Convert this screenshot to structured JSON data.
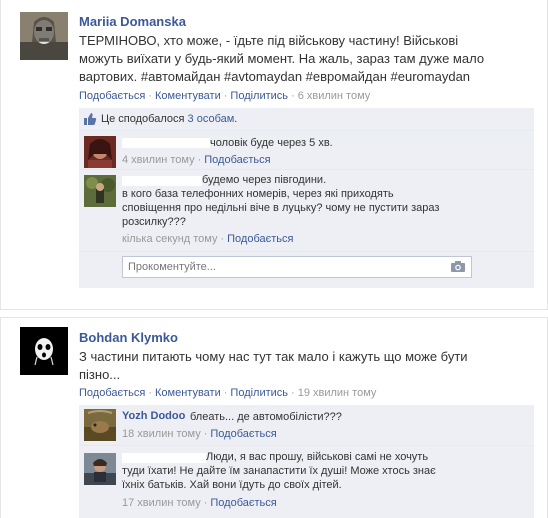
{
  "post1": {
    "author": "Mariia Domanska",
    "text_lines": [
      "ТЕРМІНОВО, хто може, - їдьте під військову частину! Військові",
      "можуть виїхати у будь-який момент. На жаль, зараз там дуже мало",
      "вартових. #автомайдан #avtomaydan #евромайдан #euromaydan"
    ],
    "actions": {
      "like": "Подобається",
      "comment": "Коментувати",
      "share": "Поділитись",
      "time": "6 хвилин тому"
    },
    "likes": {
      "prefix": "Це сподобалося ",
      "count_link": "3 особам",
      "suffix": "."
    },
    "comments": [
      {
        "text_lines": [
          "чоловік буде через 5 хв."
        ],
        "time": "4 хвилин тому",
        "like": "Подобається"
      },
      {
        "text_lines": [
          "будемо через півгодини.",
          "в кого база телефонних номерів, через які приходять",
          "сповіщення про недільні віче в луцьку? чому не пустити зараз",
          "розсилку???"
        ],
        "time": "кілька секунд тому",
        "like": "Подобається"
      }
    ],
    "reply_placeholder": "Прокоментуйте..."
  },
  "post2": {
    "author": "Bohdan Klymko",
    "text_lines": [
      "З частини питають чому нас тут так мало і кажуть що може бути",
      "пізно..."
    ],
    "actions": {
      "like": "Подобається",
      "comment": "Коментувати",
      "share": "Поділитись",
      "time": "19 хвилин тому"
    },
    "comments": [
      {
        "author": "Yozh Dodoo",
        "text_lines": [
          "блеать... де автомобілісти???"
        ],
        "time": "18 хвилин тому",
        "like": "Подобається"
      },
      {
        "text_lines": [
          "Люди, я вас прошу, військові самі не хочуть",
          "туди їхати! Не дайте їм занапастити їх душі! Може хтось знає",
          "їхніх батьків. Хай вони їдуть до своїх дітей."
        ],
        "time": "17 хвилин тому",
        "like": "Подобається"
      }
    ]
  },
  "separator": "·",
  "colors": {
    "link": "#3b5998",
    "muted": "#999999",
    "ufi_bg": "#edeff4"
  }
}
